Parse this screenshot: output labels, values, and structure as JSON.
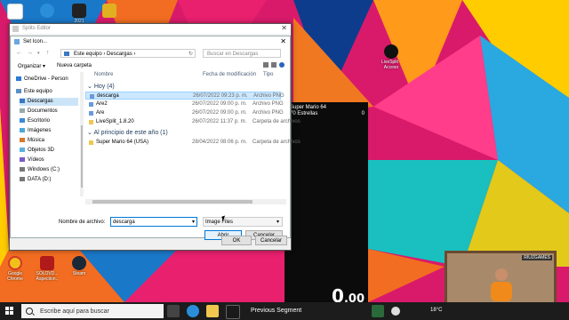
{
  "colors": {
    "accent": "#0078d7",
    "taskbar": "#1c1c1c",
    "selection": "#cce8ff"
  },
  "desktop": {
    "icons": [
      {
        "id": "chrome-old",
        "label": "",
        "icon": "chrome-icon"
      },
      {
        "id": "app-2021",
        "label": "2021",
        "icon": "app-icon"
      },
      {
        "id": "livesplit",
        "label": "LiveSplit - Acceso",
        "icon": "livesplit-icon"
      },
      {
        "id": "chrome",
        "label": "Google Chrome",
        "icon": "chrome-icon"
      },
      {
        "id": "sm2021",
        "label": "SOLOVD... Aspection..",
        "icon": "app-icon"
      },
      {
        "id": "steam",
        "label": "Steam",
        "icon": "steam-icon"
      }
    ]
  },
  "outer_dialog": {
    "title": "Splits Editor",
    "ok": "OK",
    "cancel": "Cancelar"
  },
  "file_dialog": {
    "title": "Set Icon...",
    "breadcrumb": [
      "Este equipo",
      "Descargas"
    ],
    "search_placeholder": "Buscar en Descargas",
    "organize": "Organizar ▾",
    "new_folder": "Nueva carpeta",
    "columns": {
      "name": "Nombre",
      "date": "Fecha de modificación",
      "type": "Tipo"
    },
    "sidebar": [
      {
        "label": "OneDrive - Person",
        "icon": "cloud-icon"
      },
      {
        "label": "Este equipo",
        "icon": "computer-icon"
      },
      {
        "label": "Descargas",
        "icon": "download-icon",
        "selected": true
      },
      {
        "label": "Documentos",
        "icon": "document-icon"
      },
      {
        "label": "Escritorio",
        "icon": "desktop-icon"
      },
      {
        "label": "Imágenes",
        "icon": "pictures-icon"
      },
      {
        "label": "Música",
        "icon": "music-icon"
      },
      {
        "label": "Objetos 3D",
        "icon": "cube-icon"
      },
      {
        "label": "Vídeos",
        "icon": "video-icon"
      },
      {
        "label": "Windows (C:)",
        "icon": "drive-icon"
      },
      {
        "label": "DATA (D:)",
        "icon": "drive-icon"
      }
    ],
    "groups": [
      {
        "label": "Hoy (4)",
        "rows": [
          {
            "name": "descarga",
            "date": "26/07/2022 09:23 p. m.",
            "type": "Archivo PNG",
            "icon": "image-file-icon",
            "selected": true
          },
          {
            "name": "Are2",
            "date": "26/07/2022 09:00 p. m.",
            "type": "Archivo PNG",
            "icon": "image-file-icon"
          },
          {
            "name": "Are",
            "date": "26/07/2022 09:00 p. m.",
            "type": "Archivo PNG",
            "icon": "image-file-icon"
          },
          {
            "name": "LiveSplit_1.8.20",
            "date": "26/07/2022 11:37 p. m.",
            "type": "Carpeta de archivos",
            "icon": "folder-icon"
          }
        ]
      },
      {
        "label": "Al principio de este año (1)",
        "rows": [
          {
            "name": "Super Mario 64 (USA)",
            "date": "28/04/2022 08:06 p. m.",
            "type": "Carpeta de archivos",
            "icon": "folder-icon"
          }
        ]
      }
    ],
    "filename_label": "Nombre de archivo:",
    "filename_value": "descarga",
    "filetype_value": "Image Files",
    "open": "Abrir",
    "cancel": "Cancelar"
  },
  "livesplit": {
    "title": "Super Mario 64",
    "subtitle": "70 Estrellas",
    "attempts": "0",
    "timer_main": "0",
    "timer_frac": ".00"
  },
  "taskbar": {
    "search_placeholder": "Escribe aquí para buscar",
    "previous_segment": "Previous Segment",
    "temperature": "18°C"
  },
  "webcam": {
    "tag": "RIUZGAMES"
  }
}
